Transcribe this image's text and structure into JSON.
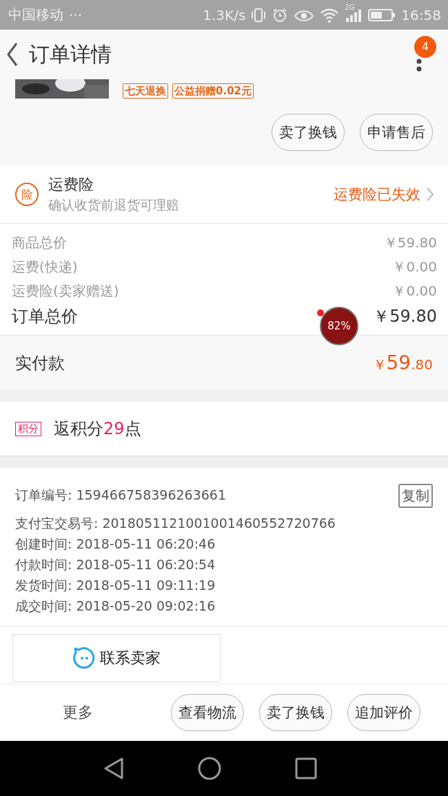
{
  "status_bar": {
    "carrier": "中国移动",
    "dots": "···",
    "speed": "1.3K/s",
    "network": "2G",
    "time": "16:58"
  },
  "header": {
    "title": "订单详情",
    "badge": "4"
  },
  "product": {
    "tags": [
      "七天退换",
      "公益捐赠0.02元"
    ]
  },
  "item_actions": [
    "卖了换钱",
    "申请售后"
  ],
  "insurance": {
    "icon_text": "险",
    "title": "运费险",
    "subtitle": "确认收货前退货可理赔",
    "status": "运费险已失效"
  },
  "price_rows": [
    {
      "label": "商品总价",
      "value": "￥59.80",
      "kind": "minor"
    },
    {
      "label": "运费(快递)",
      "value": "￥0.00",
      "kind": "minor"
    },
    {
      "label": "运费险(卖家赠送)",
      "value": "￥0.00",
      "kind": "minor"
    },
    {
      "label": "订单总价",
      "value": "￥59.80",
      "kind": "total"
    }
  ],
  "floating_widget": {
    "label": "82%"
  },
  "paid": {
    "label": "实付款",
    "currency": "￥",
    "integer": "59",
    "decimal": ".80"
  },
  "points": {
    "tag": "积分",
    "text": "返积分**29**点"
  },
  "order_info": {
    "copy_button": "复制",
    "rows": [
      "订单编号: 159466758396263661",
      "支付宝交易号: 2018051121001001460552720766",
      "创建时间: 2018-05-11 06:20:46",
      "付款时间: 2018-05-11 06:20:54",
      "发货时间: 2018-05-11 09:11:19",
      "成交时间: 2018-05-20 09:02:16"
    ]
  },
  "contact_button": "联系卖家",
  "bottom_bar": {
    "more": "更多",
    "buttons": [
      "查看物流",
      "卖了换钱",
      "追加评价"
    ]
  }
}
